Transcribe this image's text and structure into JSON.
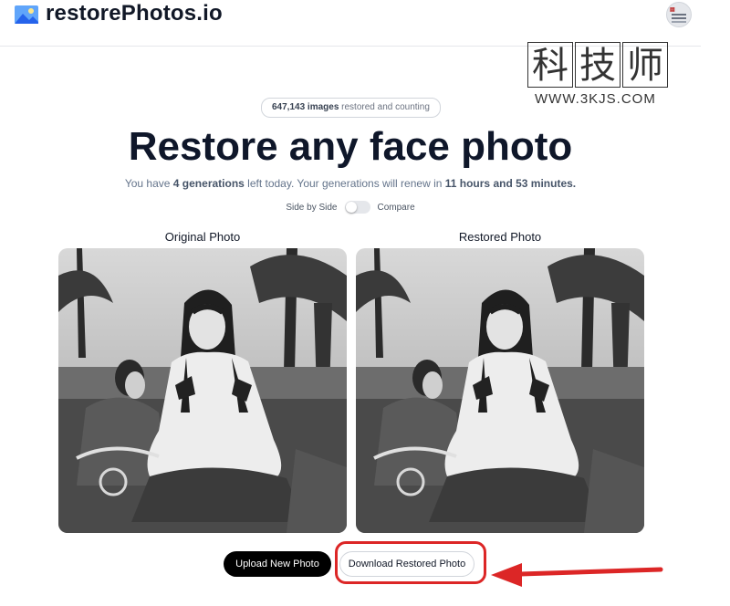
{
  "header": {
    "brand": "restorePhotos.io"
  },
  "watermark": {
    "chars": [
      "科",
      "技",
      "师"
    ],
    "url": "WWW.3KJS.COM"
  },
  "hero": {
    "count_value": "647,143 images",
    "count_suffix": " restored and counting",
    "title": "Restore any face photo",
    "gen_prefix": "You have ",
    "gen_count": "4 generations",
    "gen_mid": " left today. Your generations will renew in ",
    "gen_time": "11 hours and 53 minutes."
  },
  "view_toggle": {
    "left_label": "Side by Side",
    "right_label": "Compare",
    "compare_on": false
  },
  "panels": {
    "original_label": "Original Photo",
    "restored_label": "Restored Photo"
  },
  "actions": {
    "upload_label": "Upload New Photo",
    "download_label": "Download Restored Photo"
  },
  "colors": {
    "highlight": "#dc2626",
    "primary_button": "#000000"
  }
}
